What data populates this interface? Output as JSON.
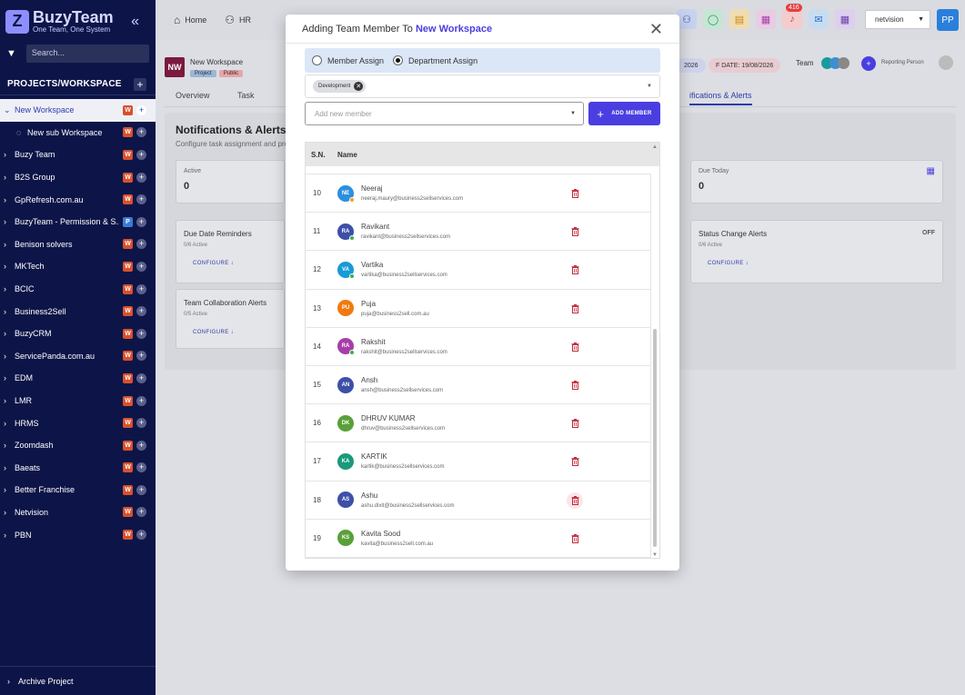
{
  "brand": {
    "name": "BuzyTeam",
    "tagline": "One Team, One System"
  },
  "sidebar": {
    "search_placeholder": "Search...",
    "section_title": "PROJECTS/WORKSPACE",
    "items": [
      {
        "label": "New Workspace",
        "badge": "W",
        "active": true
      },
      {
        "label": "New sub Workspace",
        "badge": "W",
        "sub": true
      },
      {
        "label": "Buzy Team",
        "badge": "W"
      },
      {
        "label": "B2S Group",
        "badge": "W"
      },
      {
        "label": "GpRefresh.com.au",
        "badge": "W"
      },
      {
        "label": "BuzyTeam - Permission & S...",
        "badge": "P"
      },
      {
        "label": "Benison solvers",
        "badge": "W"
      },
      {
        "label": "MKTech",
        "badge": "W"
      },
      {
        "label": "BCIC",
        "badge": "W"
      },
      {
        "label": "Business2Sell",
        "badge": "W"
      },
      {
        "label": "BuzyCRM",
        "badge": "W"
      },
      {
        "label": "ServicePanda.com.au",
        "badge": "W"
      },
      {
        "label": "EDM",
        "badge": "W"
      },
      {
        "label": "LMR",
        "badge": "W"
      },
      {
        "label": "HRMS",
        "badge": "W"
      },
      {
        "label": "Zoomdash",
        "badge": "W"
      },
      {
        "label": "Baeats",
        "badge": "W"
      },
      {
        "label": "Better Franchise",
        "badge": "W"
      },
      {
        "label": "Netvision",
        "badge": "W"
      },
      {
        "label": "PBN",
        "badge": "W"
      }
    ],
    "archive_label": "Archive Project"
  },
  "topbar": {
    "home": "Home",
    "hr": "HR",
    "notif_count": "416",
    "workspace_select": "netvision",
    "user_initials": "PP"
  },
  "workspace": {
    "initials": "NW",
    "title": "New Workspace",
    "tag_project": "Project",
    "tag_public": "Public",
    "date_partial": "2026",
    "due_date": "F DATE: 19/08/2026",
    "team_label": "Team",
    "reporting_label": "Reporting Person",
    "tabs": {
      "overview": "Overview",
      "task": "Task",
      "notif": "ifications & Alerts"
    }
  },
  "alerts_page": {
    "title": "Notifications & Alerts",
    "subtitle": "Configure task assignment and pro",
    "stat_active_label": "Active",
    "stat_active_value": "0",
    "stat_due_label": "Due Today",
    "stat_due_value": "0",
    "due_date_title": "Due Date Reminders",
    "due_date_sub": "0/6 Active",
    "status_title": "Status Change Alerts",
    "status_sub": "0/6 Active",
    "status_state": "OFF",
    "collab_title": "Team Collaboration Alerts",
    "collab_sub": "0/5 Active",
    "configure": "CONFIGURE"
  },
  "modal": {
    "title_prefix": "Adding Team Member To ",
    "title_workspace": "New Workspace",
    "radio_member": "Member Assign",
    "radio_department": "Department Assign",
    "department_chip": "Development",
    "add_placeholder": "Add new member",
    "add_button": "ADD MEMBER",
    "col_sn": "S.N.",
    "col_name": "Name",
    "members": [
      {
        "sn": "10",
        "initials": "NE",
        "name": "Neeraj",
        "email": "neeraj.maury@business2sellservices.com",
        "color": "#2b8fe0",
        "dot": "#f0a020"
      },
      {
        "sn": "11",
        "initials": "RA",
        "name": "Ravikant",
        "email": "ravikant@business2sellservices.com",
        "color": "#3d4fa8",
        "dot": "#3cb04a"
      },
      {
        "sn": "12",
        "initials": "VA",
        "name": "Vartika",
        "email": "vartika@business2sellservices.com",
        "color": "#1a9ad6",
        "dot": "#3cb04a"
      },
      {
        "sn": "13",
        "initials": "PU",
        "name": "Puja",
        "email": "puja@business2sell.com.au",
        "color": "#f07a10",
        "dot": ""
      },
      {
        "sn": "14",
        "initials": "RA",
        "name": "Rakshit",
        "email": "rakshit@business2sellservices.com",
        "color": "#a63ea8",
        "dot": "#3cb04a"
      },
      {
        "sn": "15",
        "initials": "AN",
        "name": "Ansh",
        "email": "ansh@business2sellservices.com",
        "color": "#3d4fa8",
        "dot": ""
      },
      {
        "sn": "16",
        "initials": "DK",
        "name": "DHRUV KUMAR",
        "email": "dhruv@business2sellservices.com",
        "color": "#5aa03a",
        "dot": ""
      },
      {
        "sn": "17",
        "initials": "KA",
        "name": "KARTIK",
        "email": "kartik@business2sellservices.com",
        "color": "#1a9a7a",
        "dot": ""
      },
      {
        "sn": "18",
        "initials": "AS",
        "name": "Ashu",
        "email": "ashu.dixit@business2sellservices.com",
        "color": "#3d4fa8",
        "dot": ""
      },
      {
        "sn": "19",
        "initials": "KS",
        "name": "Kavita Sood",
        "email": "kavita@business2sell.com.au",
        "color": "#5aa03a",
        "dot": ""
      }
    ]
  }
}
